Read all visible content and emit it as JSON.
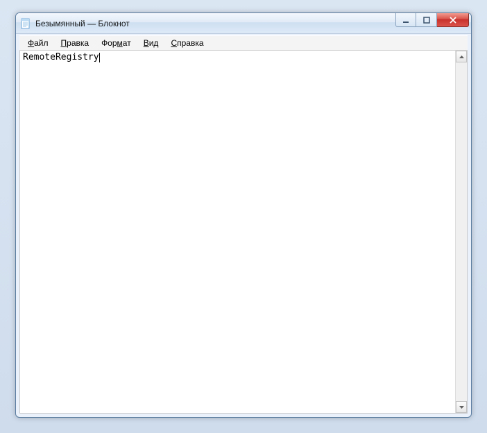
{
  "window": {
    "title": "Безымянный — Блокнот"
  },
  "menu": {
    "file": {
      "pre": "",
      "hot": "Ф",
      "post": "айл"
    },
    "edit": {
      "pre": "",
      "hot": "П",
      "post": "равка"
    },
    "format": {
      "pre": "Фор",
      "hot": "м",
      "post": "ат"
    },
    "view": {
      "pre": "",
      "hot": "В",
      "post": "ид"
    },
    "help": {
      "pre": "",
      "hot": "С",
      "post": "правка"
    }
  },
  "editor": {
    "content": "RemoteRegistry"
  }
}
